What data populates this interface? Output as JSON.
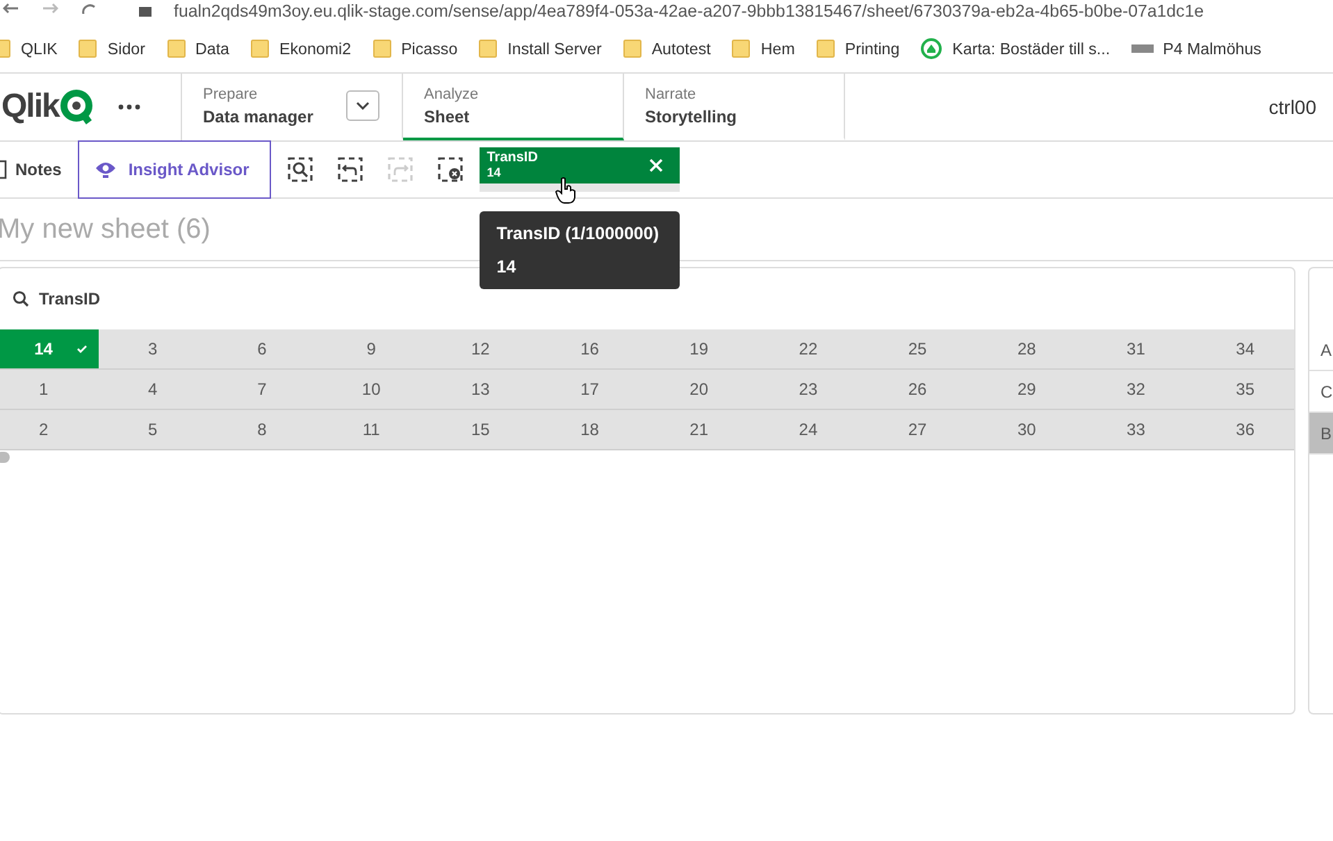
{
  "browser": {
    "url": "fualn2qds49m3oy.eu.qlik-stage.com/sense/app/4ea789f4-053a-42ae-a207-9bbb13815467/sheet/6730379a-eb2a-4b65-b0be-07a1dc1e",
    "bookmarks": [
      {
        "label": "QLIK",
        "kind": "folder"
      },
      {
        "label": "Sidor",
        "kind": "folder"
      },
      {
        "label": "Data",
        "kind": "folder"
      },
      {
        "label": "Ekonomi2",
        "kind": "folder"
      },
      {
        "label": "Picasso",
        "kind": "folder"
      },
      {
        "label": "Install Server",
        "kind": "folder"
      },
      {
        "label": "Autotest",
        "kind": "folder"
      },
      {
        "label": "Hem",
        "kind": "folder"
      },
      {
        "label": "Printing",
        "kind": "folder"
      },
      {
        "label": "Karta: Bostäder till s...",
        "kind": "site"
      },
      {
        "label": "P4 Malmöhus",
        "kind": "radio"
      }
    ]
  },
  "header": {
    "logo": "Qlik",
    "tabs": [
      {
        "caption": "Prepare",
        "label": "Data manager",
        "selected": false,
        "dropdown": true
      },
      {
        "caption": "Analyze",
        "label": "Sheet",
        "selected": true,
        "dropdown": false
      },
      {
        "caption": "Narrate",
        "label": "Storytelling",
        "selected": false,
        "dropdown": false
      }
    ],
    "user": "ctrl00"
  },
  "toolbar": {
    "notes": "Notes",
    "insight": "Insight Advisor",
    "tools": [
      {
        "kind": "search",
        "disabled": false
      },
      {
        "kind": "back",
        "disabled": false
      },
      {
        "kind": "forward",
        "disabled": true
      },
      {
        "kind": "clear",
        "disabled": false
      }
    ],
    "selection": {
      "field": "TransID",
      "value": "14"
    },
    "tooltip": {
      "title": "TransID (1/1000000)",
      "value": "14"
    }
  },
  "sheet_title": "My new sheet (6)",
  "listbox": {
    "title": "TransID",
    "rows": [
      [
        {
          "value": "14",
          "selected": true
        },
        {
          "value": "3",
          "selected": false
        },
        {
          "value": "6",
          "selected": false
        },
        {
          "value": "9",
          "selected": false
        },
        {
          "value": "12",
          "selected": false
        },
        {
          "value": "16",
          "selected": false
        },
        {
          "value": "19",
          "selected": false
        },
        {
          "value": "22",
          "selected": false
        },
        {
          "value": "25",
          "selected": false
        },
        {
          "value": "28",
          "selected": false
        },
        {
          "value": "31",
          "selected": false
        },
        {
          "value": "34",
          "selected": false
        }
      ],
      [
        {
          "value": "1",
          "selected": false
        },
        {
          "value": "4",
          "selected": false
        },
        {
          "value": "7",
          "selected": false
        },
        {
          "value": "10",
          "selected": false
        },
        {
          "value": "13",
          "selected": false
        },
        {
          "value": "17",
          "selected": false
        },
        {
          "value": "20",
          "selected": false
        },
        {
          "value": "23",
          "selected": false
        },
        {
          "value": "26",
          "selected": false
        },
        {
          "value": "29",
          "selected": false
        },
        {
          "value": "32",
          "selected": false
        },
        {
          "value": "35",
          "selected": false
        }
      ],
      [
        {
          "value": "2",
          "selected": false
        },
        {
          "value": "5",
          "selected": false
        },
        {
          "value": "8",
          "selected": false
        },
        {
          "value": "11",
          "selected": false
        },
        {
          "value": "15",
          "selected": false
        },
        {
          "value": "18",
          "selected": false
        },
        {
          "value": "21",
          "selected": false
        },
        {
          "value": "24",
          "selected": false
        },
        {
          "value": "27",
          "selected": false
        },
        {
          "value": "30",
          "selected": false
        },
        {
          "value": "33",
          "selected": false
        },
        {
          "value": "36",
          "selected": false
        }
      ]
    ]
  },
  "side_listbox": {
    "items": [
      {
        "value": "A",
        "excluded": false
      },
      {
        "value": "C",
        "excluded": false
      },
      {
        "value": "B",
        "excluded": true
      }
    ]
  }
}
